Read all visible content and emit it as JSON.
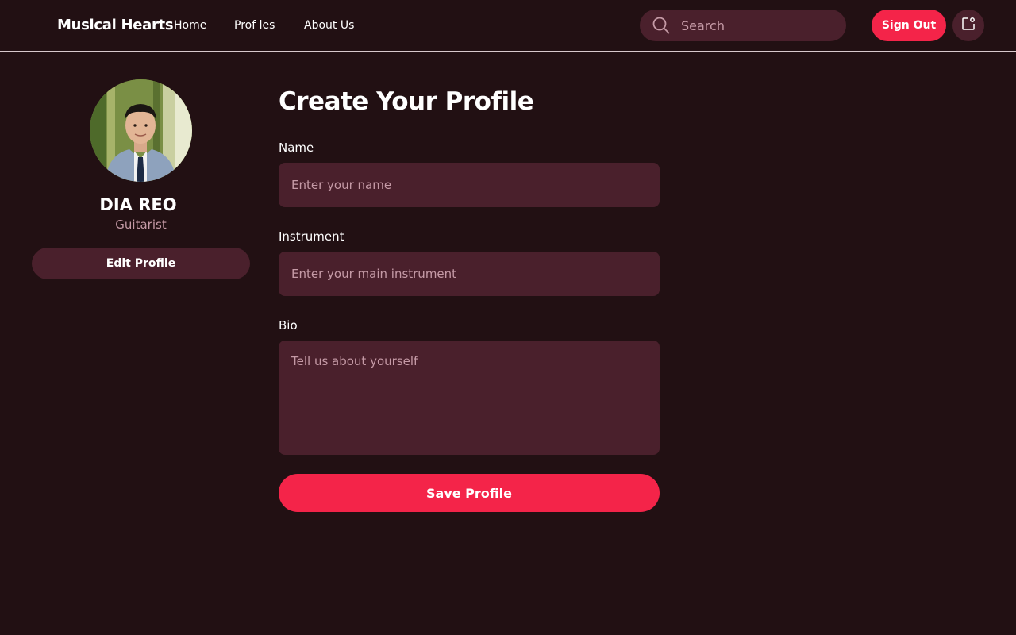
{
  "header": {
    "brand": "Musical Hearts",
    "nav": [
      "Home",
      "Prof les",
      "About Us"
    ],
    "search_placeholder": "Search",
    "signout_label": "Sign Out"
  },
  "profile": {
    "name": "DIA REO",
    "role": "Guitarist",
    "edit_label": "Edit Profile"
  },
  "form": {
    "title": "Create Your Profile",
    "name_label": "Name",
    "name_placeholder": "Enter your name",
    "instrument_label": "Instrument",
    "instrument_placeholder": "Enter your main instrument",
    "bio_label": "Bio",
    "bio_placeholder": "Tell us about yourself",
    "save_label": "Save Profile"
  },
  "icons": {
    "search": "search-icon",
    "notifications": "notification-icon"
  },
  "colors": {
    "background": "#221013",
    "surface": "#4a202c",
    "accent": "#f42449",
    "muted_text": "#c59aa6"
  }
}
